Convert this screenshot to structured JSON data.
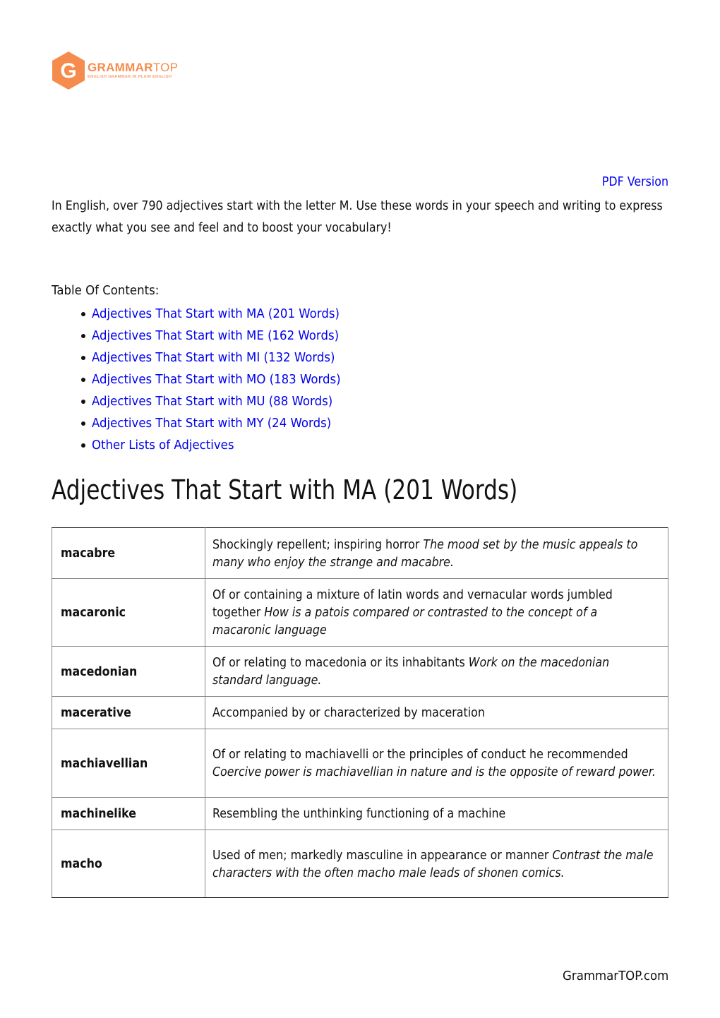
{
  "brand": {
    "logo_letter": "G",
    "name_bold": "GRAMMAR",
    "name_thin": "TOP",
    "tagline": "ENGLISH GRAMMAR IN PLAIN ENGLISH",
    "color": "#f58b4c"
  },
  "pdf_link": "PDF Version",
  "intro": "In English, over 790 adjectives start with the letter M. Use these words in your speech and writing to express exactly what you see and feel and to boost your vocabulary!",
  "toc": {
    "title": "Table Of Contents:",
    "items": [
      "Adjectives That Start with MA (201 Words)",
      "Adjectives That Start with ME (162 Words)",
      "Adjectives That Start with MI (132 Words)",
      "Adjectives That Start with MO (183 Words)",
      "Adjectives That Start with MU (88 Words)",
      "Adjectives That Start with MY (24 Words)",
      "Other Lists of Adjectives"
    ]
  },
  "section": {
    "heading": "Adjectives That Start with MA (201 Words)",
    "rows": [
      {
        "word": "macabre",
        "definition": "Shockingly repellent; inspiring horror",
        "example": "The mood set by the music appeals to many who enjoy the strange and macabre."
      },
      {
        "word": "macaronic",
        "definition": "Of or containing a mixture of latin words and vernacular words jumbled together",
        "example": "How is a patois compared or contrasted to the concept of a macaronic language"
      },
      {
        "word": "macedonian",
        "definition": "Of or relating to macedonia or its inhabitants",
        "example": "Work on the macedonian standard language."
      },
      {
        "word": "macerative",
        "definition": "Accompanied by or characterized by maceration",
        "example": ""
      },
      {
        "word": "machiavellian",
        "definition": "Of or relating to machiavelli or the principles of conduct he recommended",
        "example": "Coercive power is machiavellian in nature and is the opposite of reward power."
      },
      {
        "word": "machinelike",
        "definition": "Resembling the unthinking functioning of a machine",
        "example": ""
      },
      {
        "word": "macho",
        "definition": "Used of men; markedly masculine in appearance or manner",
        "example": "Contrast the male characters with the often macho male leads of shonen comics."
      }
    ]
  },
  "footer": "GrammarTOP.com"
}
